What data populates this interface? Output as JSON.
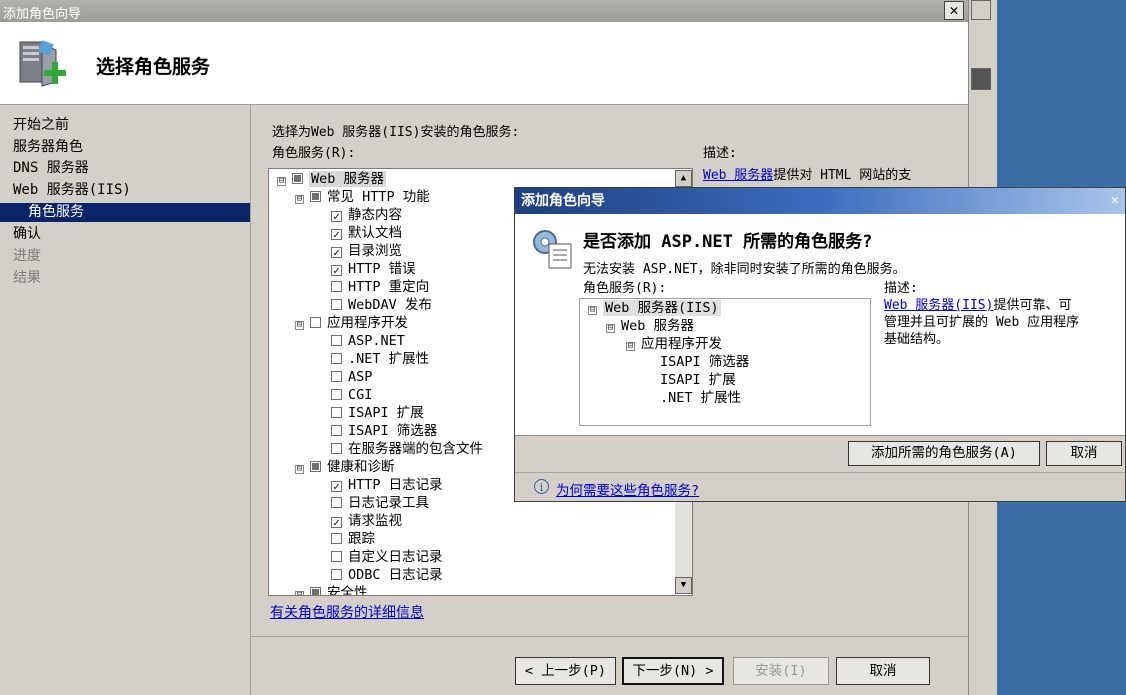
{
  "window": {
    "title": "添加角色向导",
    "close_glyph": "✕",
    "header_title": "选择角色服务"
  },
  "nav": {
    "items": [
      {
        "label": "开始之前",
        "state": "normal"
      },
      {
        "label": "服务器角色",
        "state": "normal"
      },
      {
        "label": "DNS 服务器",
        "state": "normal"
      },
      {
        "label": "Web 服务器(IIS)",
        "state": "normal"
      },
      {
        "label": "角色服务",
        "state": "selected"
      },
      {
        "label": "确认",
        "state": "normal"
      },
      {
        "label": "进度",
        "state": "disabled"
      },
      {
        "label": "结果",
        "state": "disabled"
      }
    ]
  },
  "main": {
    "instruction": "选择为Web 服务器(IIS)安装的角色服务:",
    "list_label": "角色服务(R):",
    "desc_label": "描述:",
    "desc_link": "Web 服务器",
    "desc_text": "提供对 HTML 网站的支",
    "more_info_link": "有关角色服务的详细信息"
  },
  "tree": [
    {
      "label": "Web 服务器",
      "check": "partial",
      "expander": "⊟",
      "selected": true
    },
    {
      "label": "常见 HTTP 功能",
      "check": "partial",
      "expander": "⊟"
    },
    {
      "label": "静态内容",
      "check": "checked"
    },
    {
      "label": "默认文档",
      "check": "checked"
    },
    {
      "label": "目录浏览",
      "check": "checked"
    },
    {
      "label": "HTTP 错误",
      "check": "checked"
    },
    {
      "label": "HTTP 重定向",
      "check": "unchecked"
    },
    {
      "label": "WebDAV 发布",
      "check": "unchecked"
    },
    {
      "label": "应用程序开发",
      "check": "unchecked",
      "expander": "⊟"
    },
    {
      "label": "ASP.NET",
      "check": "unchecked"
    },
    {
      "label": ".NET 扩展性",
      "check": "unchecked"
    },
    {
      "label": "ASP",
      "check": "unchecked"
    },
    {
      "label": "CGI",
      "check": "unchecked"
    },
    {
      "label": "ISAPI 扩展",
      "check": "unchecked"
    },
    {
      "label": "ISAPI 筛选器",
      "check": "unchecked"
    },
    {
      "label": "在服务器端的包含文件",
      "check": "unchecked"
    },
    {
      "label": "健康和诊断",
      "check": "partial",
      "expander": "⊟"
    },
    {
      "label": "HTTP 日志记录",
      "check": "checked"
    },
    {
      "label": "日志记录工具",
      "check": "unchecked"
    },
    {
      "label": "请求监视",
      "check": "checked"
    },
    {
      "label": "跟踪",
      "check": "unchecked"
    },
    {
      "label": "自定义日志记录",
      "check": "unchecked"
    },
    {
      "label": "ODBC 日志记录",
      "check": "unchecked"
    },
    {
      "label": "安全性",
      "check": "partial",
      "expander": "⊟"
    }
  ],
  "buttons": {
    "prev": "< 上一步(P)",
    "next": "下一步(N) >",
    "install": "安装(I)",
    "cancel": "取消"
  },
  "dialog": {
    "title": "添加角色向导",
    "close_glyph": "✕",
    "heading": "是否添加 ASP.NET 所需的角色服务?",
    "message": "无法安装 ASP.NET，除非同时安装了所需的角色服务。",
    "list_label": "角色服务(R):",
    "desc_label": "描述:",
    "desc_link": "Web 服务器(IIS)",
    "desc_line1": "提供可靠、可",
    "desc_line2": "管理并且可扩展的 Web 应用程序",
    "desc_line3": "基础结构。",
    "tree": [
      {
        "label": "Web 服务器(IIS)",
        "expander": "⊟",
        "selected": true
      },
      {
        "label": "Web 服务器",
        "expander": "⊟"
      },
      {
        "label": "应用程序开发",
        "expander": "⊟"
      },
      {
        "label": "ISAPI 筛选器"
      },
      {
        "label": "ISAPI 扩展"
      },
      {
        "label": ".NET 扩展性"
      }
    ],
    "add_button": "添加所需的角色服务(A)",
    "cancel_button": "取消",
    "help_link": "为何需要这些角色服务?"
  },
  "colors": {
    "nav_selected": "#0a246a",
    "link": "#0000cc",
    "desktop": "#3a6ea5"
  }
}
